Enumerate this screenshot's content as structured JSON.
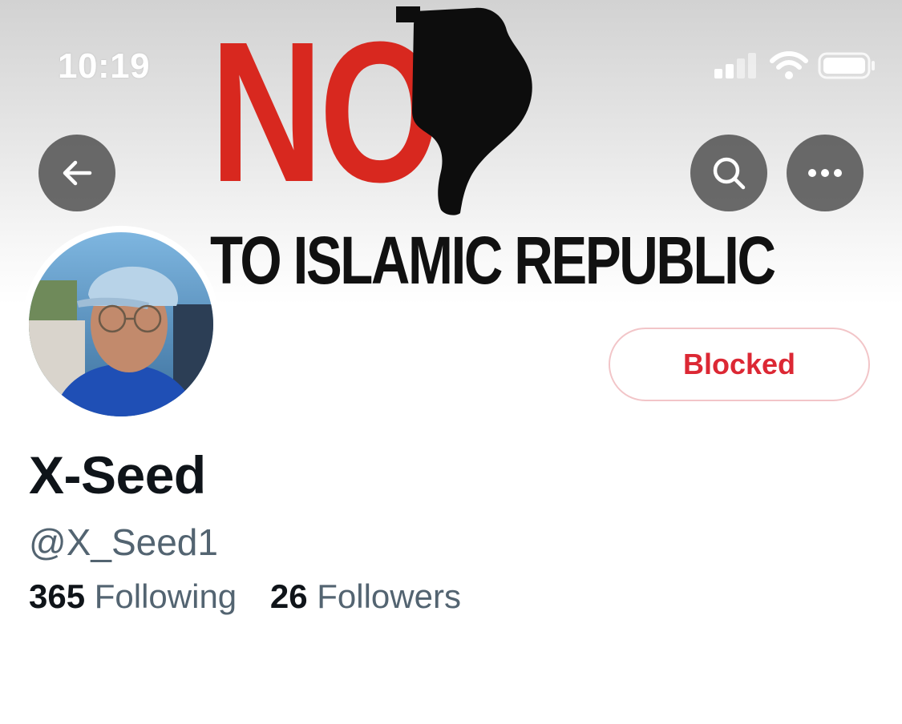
{
  "status_bar": {
    "time": "10:19",
    "icons": [
      "signal-icon",
      "wifi-icon",
      "battery-icon"
    ]
  },
  "banner": {
    "headline": "NO",
    "tagline": "TO ISLAMIC REPUBLIC",
    "colors": {
      "headline": "#d8281f",
      "tagline": "#111111"
    }
  },
  "nav": {
    "back_icon": "arrow-left-icon",
    "search_icon": "search-icon",
    "more_icon": "more-horizontal-icon"
  },
  "profile": {
    "display_name": "X-Seed",
    "handle": "@X_Seed1",
    "following_count": "365",
    "following_label": "Following",
    "followers_count": "26",
    "followers_label": "Followers",
    "blocked_label": "Blocked"
  },
  "colors": {
    "blocked": "#dc2834",
    "secondary_text": "#536471",
    "primary_text": "#0f1419"
  }
}
